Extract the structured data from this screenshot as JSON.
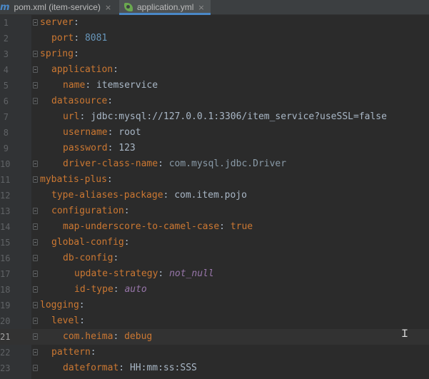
{
  "tabs": [
    {
      "label": "pom.xml (item-service)",
      "close": "×",
      "icon": "maven-m-icon"
    },
    {
      "label": "application.yml",
      "close": "×",
      "icon": "spring-leaf-icon"
    }
  ],
  "lines": [
    {
      "num": "1",
      "key": "server",
      "sep": ":",
      "val": "",
      "vtype": ""
    },
    {
      "num": "2",
      "key": "port",
      "sep": ": ",
      "val": "8081",
      "vtype": "n"
    },
    {
      "num": "3",
      "key": "spring",
      "sep": ":",
      "val": "",
      "vtype": ""
    },
    {
      "num": "4",
      "key": "application",
      "sep": ":",
      "val": "",
      "vtype": ""
    },
    {
      "num": "5",
      "key": "name",
      "sep": ": ",
      "val": "itemservice",
      "vtype": "v"
    },
    {
      "num": "6",
      "key": "datasource",
      "sep": ":",
      "val": "",
      "vtype": ""
    },
    {
      "num": "7",
      "key": "url",
      "sep": ": ",
      "val": "jdbc:mysql://127.0.0.1:3306/item_service?useSSL=false",
      "vtype": "v"
    },
    {
      "num": "8",
      "key": "username",
      "sep": ": ",
      "val": "root",
      "vtype": "v"
    },
    {
      "num": "9",
      "key": "password",
      "sep": ": ",
      "val": "123",
      "vtype": "v"
    },
    {
      "num": "10",
      "key": "driver-class-name",
      "sep": ": ",
      "val": "com.mysql.jdbc.Driver",
      "vtype": "cls"
    },
    {
      "num": "11",
      "key": "mybatis-plus",
      "sep": ":",
      "val": "",
      "vtype": ""
    },
    {
      "num": "12",
      "key": "type-aliases-package",
      "sep": ": ",
      "val": "com.item.pojo",
      "vtype": "v"
    },
    {
      "num": "13",
      "key": "configuration",
      "sep": ":",
      "val": "",
      "vtype": ""
    },
    {
      "num": "14",
      "key": "map-underscore-to-camel-case",
      "sep": ": ",
      "val": "true",
      "vtype": "bool"
    },
    {
      "num": "15",
      "key": "global-config",
      "sep": ":",
      "val": "",
      "vtype": ""
    },
    {
      "num": "16",
      "key": "db-config",
      "sep": ":",
      "val": "",
      "vtype": ""
    },
    {
      "num": "17",
      "key": "update-strategy",
      "sep": ": ",
      "val": "not_null",
      "vtype": "e"
    },
    {
      "num": "18",
      "key": "id-type",
      "sep": ": ",
      "val": "auto",
      "vtype": "e"
    },
    {
      "num": "19",
      "key": "logging",
      "sep": ":",
      "val": "",
      "vtype": ""
    },
    {
      "num": "20",
      "key": "level",
      "sep": ":",
      "val": "",
      "vtype": ""
    },
    {
      "num": "21",
      "key": "com.heima",
      "sep": ": ",
      "val": "debug",
      "vtype": "bool"
    },
    {
      "num": "22",
      "key": "pattern",
      "sep": ":",
      "val": "",
      "vtype": ""
    },
    {
      "num": "23",
      "key": "dateformat",
      "sep": ": ",
      "val": "HH:mm:ss:SSS",
      "vtype": "v"
    }
  ],
  "current_line": "21",
  "mouse_cursor_icon": "text-ibeam-cursor-icon"
}
